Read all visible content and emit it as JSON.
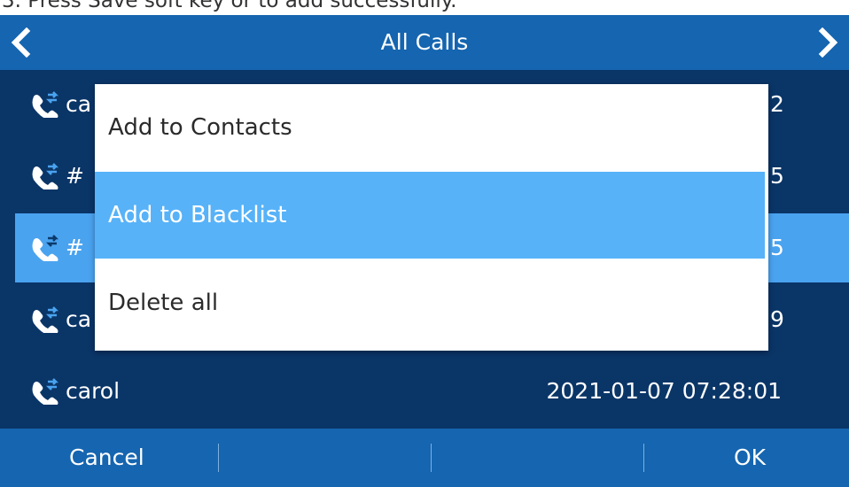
{
  "caption": "3. Press Save soft key or          to add successfully.",
  "header": {
    "title": "All Calls",
    "back_icon": "chevron-left-icon",
    "forward_icon": "chevron-right-icon"
  },
  "calls": [
    {
      "name": "ca",
      "time_fragment": "2",
      "icon": "call-icon"
    },
    {
      "name": "#",
      "time_fragment": "5",
      "icon": "call-icon"
    },
    {
      "name": "#",
      "time_fragment": "5",
      "icon": "call-icon",
      "selected": true
    },
    {
      "name": "ca",
      "time_fragment": "9",
      "icon": "call-icon"
    },
    {
      "name": "carol",
      "time": "2021-01-07 07:28:01",
      "icon": "call-icon"
    }
  ],
  "menu": {
    "items": [
      {
        "label": "Add to Contacts"
      },
      {
        "label": "Add to Blacklist",
        "highlighted": true
      },
      {
        "label": "Delete all"
      }
    ]
  },
  "softkeys": {
    "left": "Cancel",
    "right": "OK"
  },
  "colors": {
    "header": "#1565b0",
    "list_bg": "#0a3567",
    "selected_row": "#4aa3ef",
    "menu_highlight": "#57b2f8"
  }
}
